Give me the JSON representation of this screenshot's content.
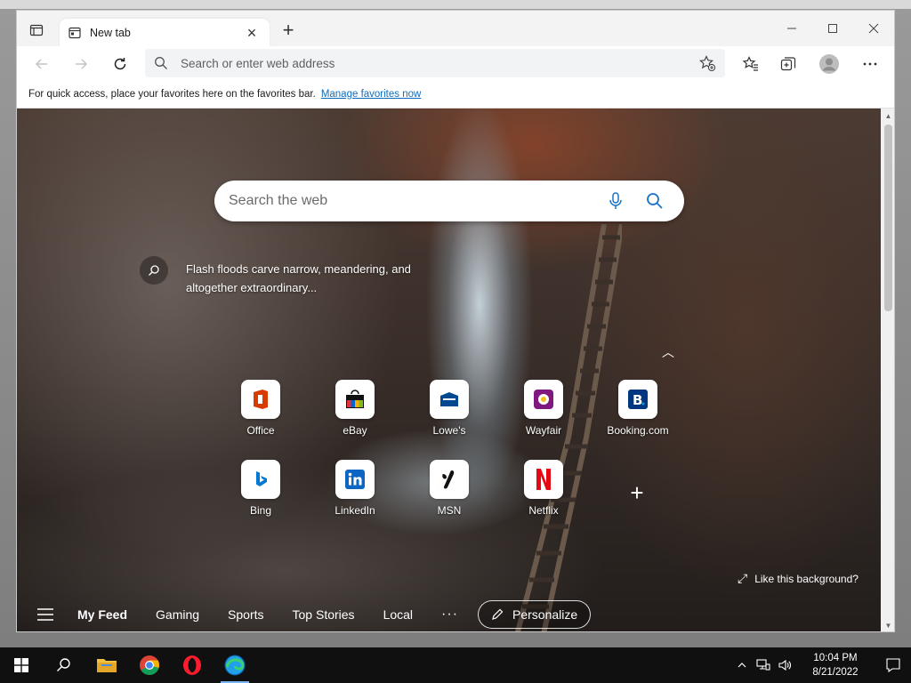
{
  "browser": {
    "tab": {
      "title": "New tab",
      "icon": "new-tab-page-icon"
    },
    "address_placeholder": "Search or enter web address",
    "favorites_bar": {
      "message": "For quick access, place your favorites here on the favorites bar.",
      "link": "Manage favorites now"
    }
  },
  "new_tab_page": {
    "search_placeholder": "Search the web",
    "image_caption": "Flash floods carve narrow, meandering, and altogether extraordinary...",
    "quick_links": [
      {
        "label": "Office",
        "icon": "office-icon",
        "color": "#d83b01"
      },
      {
        "label": "eBay",
        "icon": "ebay-icon",
        "color": "#e53238"
      },
      {
        "label": "Lowe's",
        "icon": "lowes-icon",
        "color": "#004990"
      },
      {
        "label": "Wayfair",
        "icon": "wayfair-icon",
        "color": "#7f187f"
      },
      {
        "label": "Booking.com",
        "icon": "booking-icon",
        "color": "#003580"
      },
      {
        "label": "Bing",
        "icon": "bing-icon",
        "color": "#0078d4"
      },
      {
        "label": "LinkedIn",
        "icon": "linkedin-icon",
        "color": "#0a66c2"
      },
      {
        "label": "MSN",
        "icon": "msn-icon",
        "color": "#000000"
      },
      {
        "label": "Netflix",
        "icon": "netflix-icon",
        "color": "#e50914"
      }
    ],
    "like_background": "Like this background?",
    "feed_tabs": [
      "My Feed",
      "Gaming",
      "Sports",
      "Top Stories",
      "Local"
    ],
    "more_label": "···",
    "personalize_label": "Personalize"
  },
  "taskbar": {
    "apps": [
      "start-icon",
      "search-icon",
      "file-explorer-icon",
      "chrome-icon",
      "opera-icon",
      "edge-icon"
    ],
    "time": "10:04 PM",
    "date": "8/21/2022"
  }
}
